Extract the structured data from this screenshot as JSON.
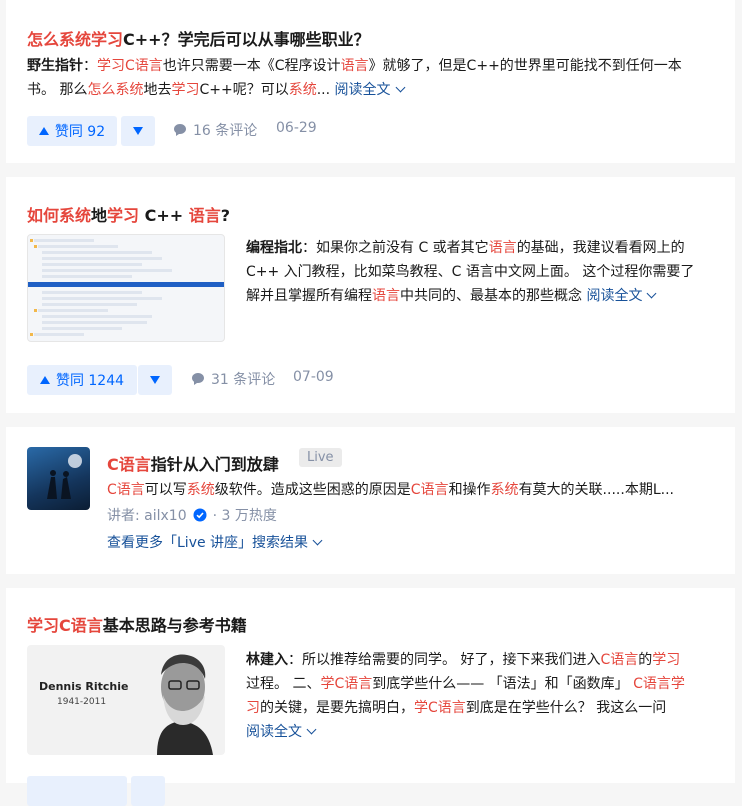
{
  "card1": {
    "title_parts": [
      "怎么系统学习",
      "C++？学完后可以从事哪些职业？"
    ],
    "author": "野生指针",
    "excerpt_l1": [
      "：",
      "学习C语言",
      "也许只需要一本《C程序设计",
      "语言",
      "》就够了，但是C++的世界里可能找不到任何一本"
    ],
    "excerpt_l2": [
      "书。 那么",
      "怎么系统",
      "地去",
      "学习",
      "C++呢？可以",
      "系统",
      "..."
    ],
    "read_more": "阅读全文",
    "upvote": "赞同 92",
    "comments": "16 条评论",
    "date": "06-29"
  },
  "card2": {
    "title_parts": [
      "如何系统",
      "地",
      "学习",
      " C++ ",
      "语言",
      "?"
    ],
    "author": "编程指北",
    "excerpt_l1": [
      "：如果你之前没有 C 或者其它",
      "语言",
      "的基础，我建议看看网上的"
    ],
    "excerpt_l2": "C++ 入门教程，比如菜鸟教程、C 语言中文网上面。 这个过程你需要了",
    "excerpt_l3": [
      "解并且掌握所有编程",
      "语言",
      "中共同的、最基本的那些概念"
    ],
    "read_more": "阅读全文",
    "upvote": "赞同 1244",
    "comments": "31 条评论",
    "date": "07-09"
  },
  "card3": {
    "title_parts": [
      "C语言",
      "指针从入门到放肆"
    ],
    "tag": "Live",
    "excerpt": [
      "C语言",
      "可以写",
      "系统",
      "级软件。造成这些困惑的原因是",
      "C语言",
      "和操作",
      "系统",
      "有莫大的关联.....本期L..."
    ],
    "lecturer": "讲者: ailx10",
    "heat": "· 3 万热度",
    "more_results": "查看更多「Live 讲座」搜索结果"
  },
  "card4": {
    "title_parts": [
      "学习C语言",
      "基本思路与参考书籍"
    ],
    "image_caption": "Dennis Ritchie",
    "image_years": "1941-2011",
    "author": "林建入",
    "excerpt_l1": [
      "：所以推荐给需要的同学。 好了，接下来我们进入",
      "C语言",
      "的",
      "学习"
    ],
    "excerpt_l2": [
      "过程。 二、",
      "学C语言",
      "到底学些什么—— 「语法」和「函数库」 ",
      "C语言学"
    ],
    "excerpt_l3": [
      "习",
      "的关键，是要先搞明白，",
      "学C语言",
      "到底是在学些什么？ 我这么一问"
    ],
    "read_more": "阅读全文"
  },
  "colors": {
    "highlight": "#e5463c",
    "link": "#175199",
    "vote": "#0066ff",
    "meta": "#8590a6"
  }
}
